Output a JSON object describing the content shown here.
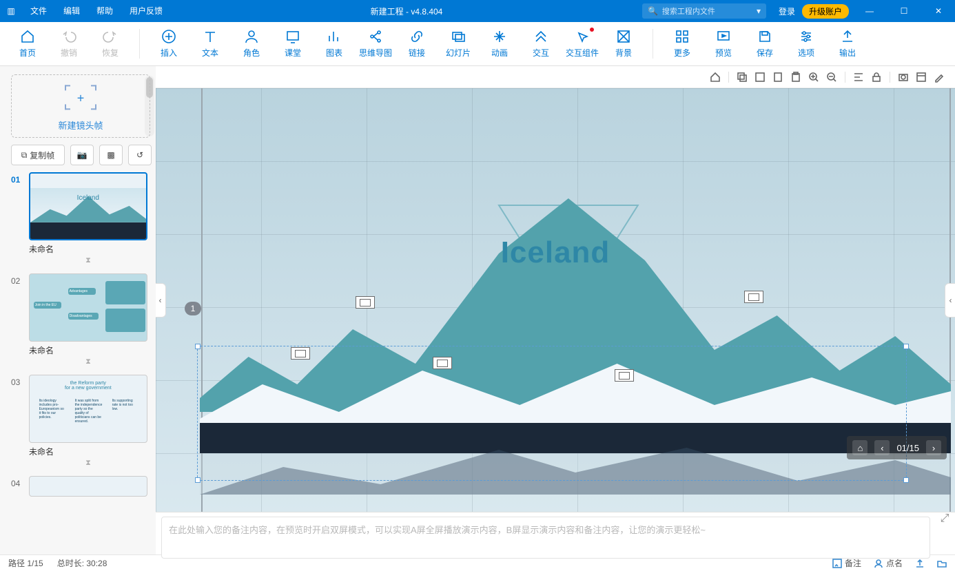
{
  "titlebar": {
    "menus": [
      "文件",
      "编辑",
      "帮助",
      "用户反馈"
    ],
    "title": "新建工程 - v4.8.404",
    "search_placeholder": "搜索工程内文件",
    "login": "登录",
    "upgrade": "升级账户"
  },
  "toolbar": {
    "home": "首页",
    "undo": "撤销",
    "redo": "恢复",
    "insert": "插入",
    "text": "文本",
    "role": "角色",
    "class": "课堂",
    "chart": "图表",
    "mindmap": "思维导图",
    "link": "链接",
    "slide": "幻灯片",
    "anim": "动画",
    "interact": "交互",
    "interact_comp": "交互组件",
    "bg": "背景",
    "more": "更多",
    "preview": "预览",
    "save": "保存",
    "options": "选项",
    "output": "输出"
  },
  "sidebar": {
    "new_frame": "新建镜头帧",
    "copy_frame": "复制帧",
    "slides": [
      {
        "num": "01",
        "title": "未命名",
        "hint": "Iceland"
      },
      {
        "num": "02",
        "title": "未命名"
      },
      {
        "num": "03",
        "title": "未命名",
        "reform1": "the Reform party",
        "reform2": "for a new government"
      },
      {
        "num": "04",
        "title": ""
      }
    ]
  },
  "canvas": {
    "title_text": "Iceland",
    "index_badge": "1",
    "nav_page": "01/15"
  },
  "notes": {
    "placeholder": "在此处输入您的备注内容，在预览时开启双屏模式，可以实现A屏全屏播放演示内容，B屏显示演示内容和备注内容，让您的演示更轻松~"
  },
  "statusbar": {
    "path": "路径 1/15",
    "duration": "总时长: 30:28",
    "remark": "备注",
    "roll": "点名"
  }
}
